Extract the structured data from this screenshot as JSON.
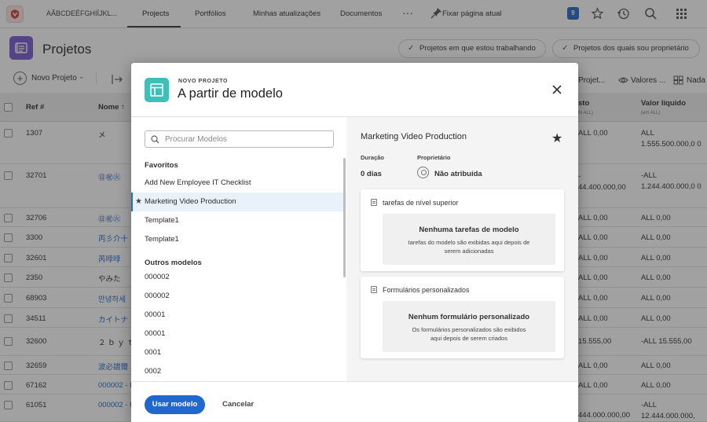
{
  "topnav": {
    "org_name": "AÃBCDEËFGHIÏJKL...",
    "tabs": [
      "Projects",
      "Portfólios",
      "Minhas atualizações",
      "Documentos"
    ],
    "more": "···",
    "pin_label": "Fixar página atual",
    "notif_count": "9",
    "icons": [
      "star-icon",
      "history-icon",
      "search-icon",
      "apps-grid-icon"
    ]
  },
  "page": {
    "title": "Projetos",
    "filters": [
      "Projetos em que estou trabalhando",
      "Projetos dos quais sou proprietário"
    ]
  },
  "toolbar": {
    "new_label": "Novo Projeto",
    "right_items": [
      "Projet...",
      "Valores ...",
      "Nada"
    ]
  },
  "table": {
    "headers": {
      "ref": "Ref #",
      "name": "Nome ↑",
      "cost": "sto",
      "cost_sub": "m ALL)",
      "net": "Valor líquido",
      "net_sub": "(em ALL)"
    },
    "rows": [
      {
        "ref": "1307",
        "name": "メ",
        "cost": "ALL 0,00",
        "net": "ALL 1.555.500.000,0 0"
      },
      {
        "ref": "32701",
        "name": "㊐㊗㊋",
        "cost": "44.400.000,00",
        "cost_pre": "-",
        "net": "-ALL 1.244.400.000,0 0"
      },
      {
        "ref": "32706",
        "name": "㊐㊗㊋",
        "cost": "ALL 0,00",
        "net": "ALL 0,00"
      },
      {
        "ref": "3300",
        "name": "丙彡介十",
        "cost": "ALL 0,00",
        "net": "ALL 0,00"
      },
      {
        "ref": "32601",
        "name": "芮哱哱",
        "cost": "ALL 0,00",
        "net": "ALL 0,00"
      },
      {
        "ref": "2350",
        "name": "やみた",
        "cost": "ALL 0,00",
        "net": "ALL 0,00"
      },
      {
        "ref": "68903",
        "name": "안녕하세",
        "cost": "ALL 0,00",
        "net": "ALL 0,00"
      },
      {
        "ref": "34511",
        "name": "カイトナ",
        "cost": "ALL 0,00",
        "net": "ALL 0,00"
      },
      {
        "ref": "32600",
        "name": "２ ｂ ｙ ｔ",
        "cost": "15.555,00",
        "net": "-ALL 15.555,00"
      },
      {
        "ref": "32659",
        "name": "波必譜爾",
        "cost": "ALL 0,00",
        "net": "ALL 0,00"
      },
      {
        "ref": "67162",
        "name": "000002 - P",
        "cost": "ALL 0,00",
        "net": "ALL 0,00"
      },
      {
        "ref": "61051",
        "name": "000002 - P",
        "cost": "444.000.000,00",
        "net": "-ALL 12.444.000.000,"
      }
    ]
  },
  "modal": {
    "overline": "NOVO PROJETO",
    "title": "A partir de modelo",
    "search_placeholder": "Procurar Modelos",
    "favorites_label": "Favoritos",
    "favorites": [
      "Add New Employee IT Checklist",
      "Marketing Video Production",
      "Template1",
      "Template1"
    ],
    "others_label": "Outros modelos",
    "others": [
      "000002",
      "000002",
      "00001",
      "00001",
      "0001",
      "0002"
    ],
    "selected": {
      "name": "Marketing Video Production",
      "duration_label": "Duração",
      "duration": "0 dias",
      "owner_label": "Proprietário",
      "owner": "Não atribuída"
    },
    "tasks_card": {
      "title": "tarefas de nível superior",
      "empty_title": "Nenhuma tarefas de modelo",
      "empty_desc": "tarefas do modelo são exibidas aqui depois de serem adicionadas"
    },
    "forms_card": {
      "title": "Formulários personalizados",
      "empty_title": "Nenhum formulário personalizado",
      "empty_desc": "Os formulários personalizados são exibidos aqui depois de serem criados"
    },
    "use_button": "Usar modelo",
    "cancel_button": "Cancelar"
  },
  "colors": {
    "primary": "#2067ce",
    "page_icon": "#7d5fcf",
    "modal_icon": "#3fbfb7",
    "badge": "#2b6cc6"
  }
}
